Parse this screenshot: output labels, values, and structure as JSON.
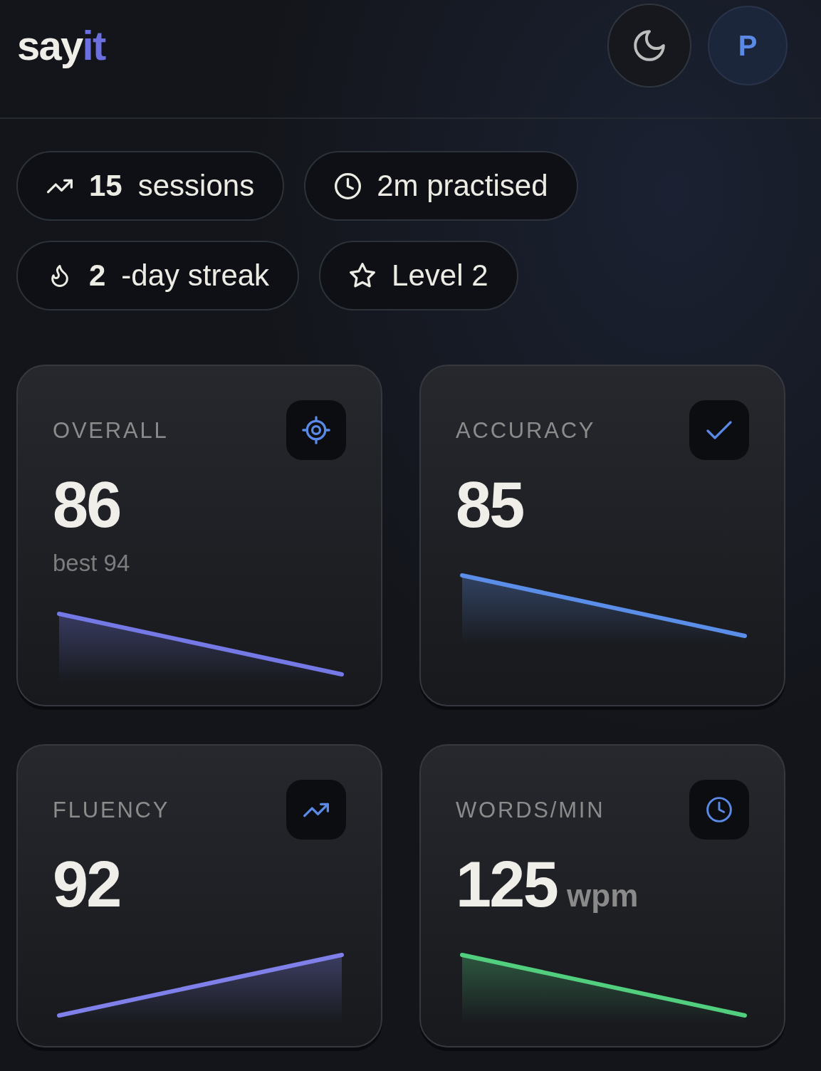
{
  "header": {
    "logo": {
      "text": "say",
      "accent": "it"
    },
    "avatar": {
      "initial": "P"
    }
  },
  "stats": [
    {
      "kind": "sessions",
      "value": "15",
      "label": "sessions"
    },
    {
      "kind": "time",
      "label": "2m practised"
    },
    {
      "kind": "streak",
      "value": "2",
      "label": "-day streak"
    },
    {
      "kind": "level",
      "label": "Level 2"
    }
  ],
  "cards": [
    {
      "kind": "overall",
      "label": "OVERALL",
      "value": "86",
      "note": "best 94",
      "rising": false,
      "color": "#7479e6"
    },
    {
      "kind": "accuracy",
      "label": "ACCURACY",
      "value": "85",
      "rising": false,
      "color": "#5b8ee8"
    },
    {
      "kind": "fluency",
      "label": "FLUENCY",
      "value": "92",
      "rising": true,
      "color": "#7f80ea"
    },
    {
      "kind": "speed",
      "label": "WORDS/MIN",
      "value": "125",
      "unit": "wpm",
      "rising": false,
      "color": "#52cf7e"
    }
  ]
}
